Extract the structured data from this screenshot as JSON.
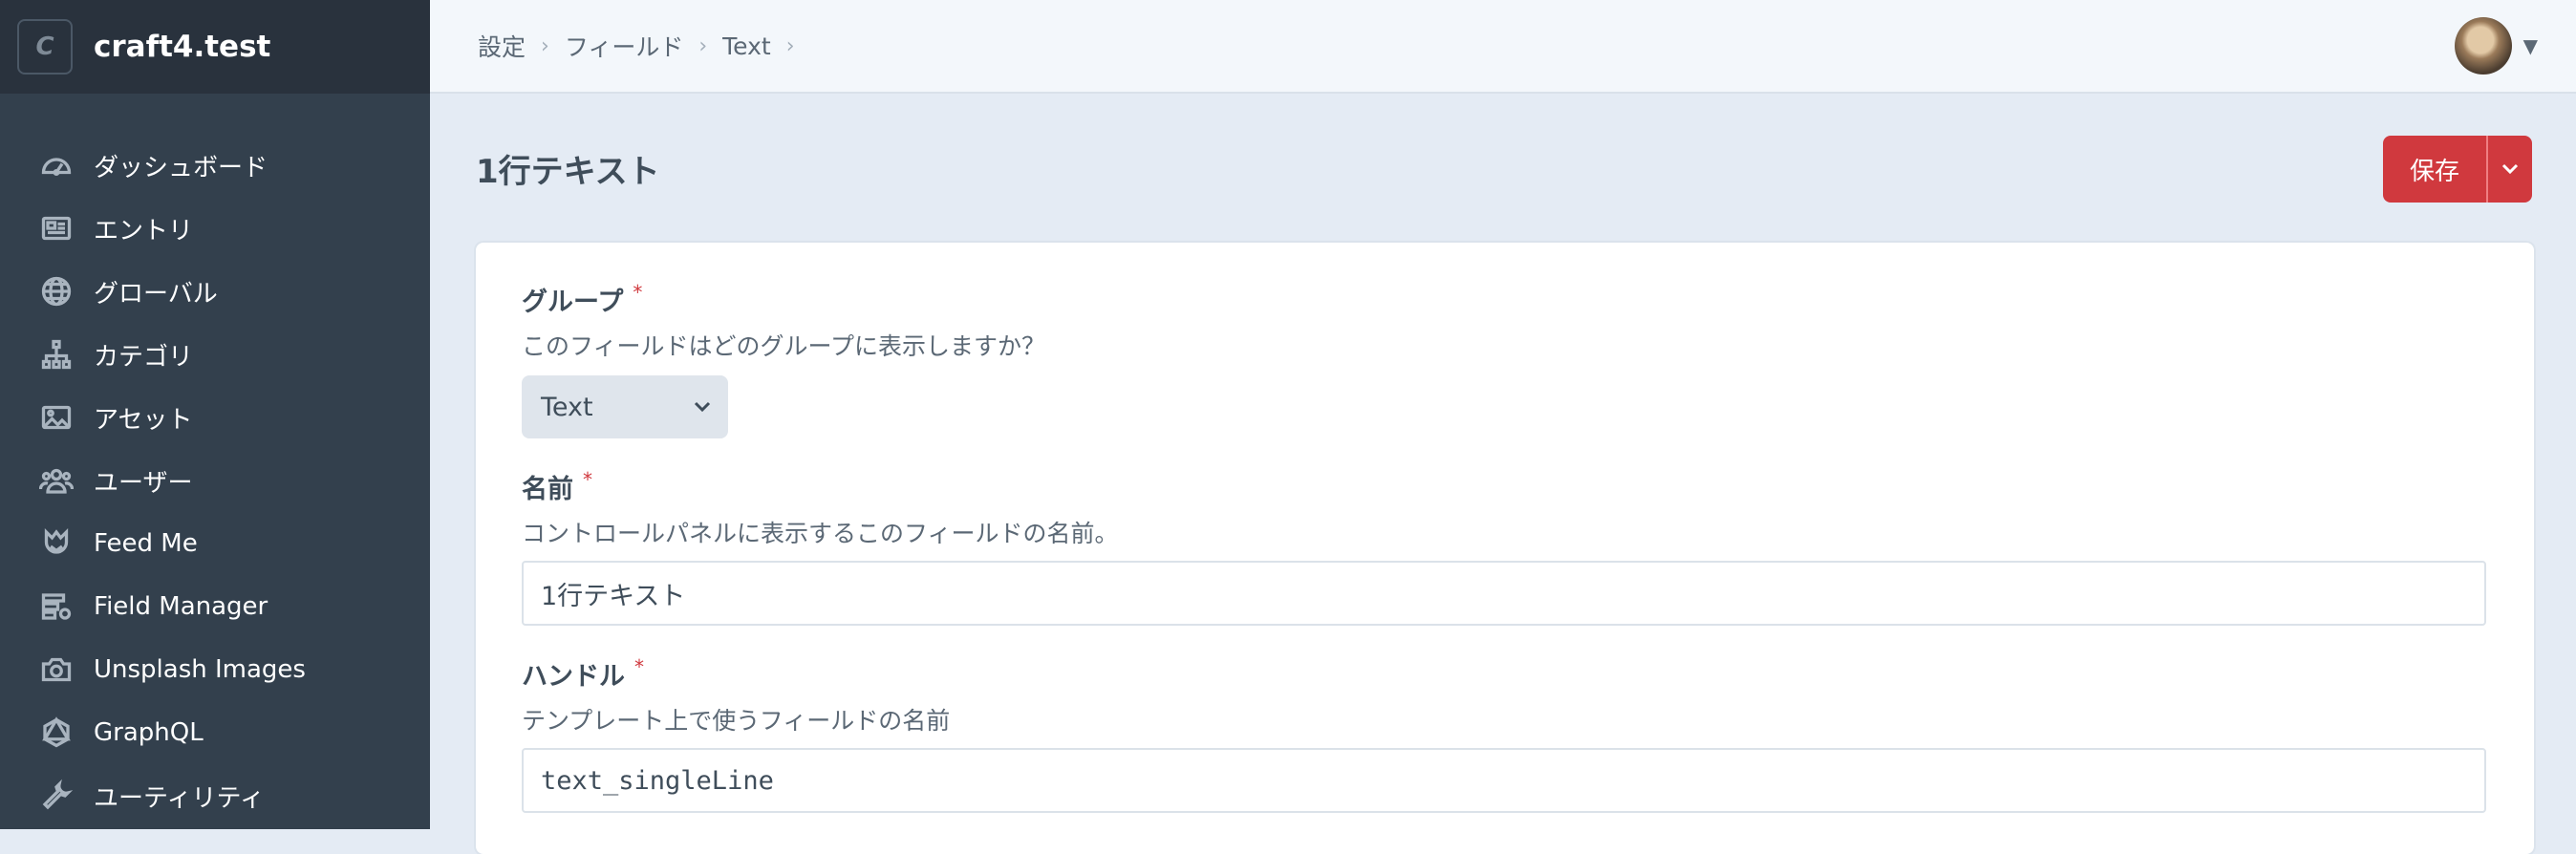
{
  "sidebar": {
    "site_icon": "C",
    "site_name": "craft4.test",
    "items": [
      {
        "label": "ダッシュボード",
        "icon": "gauge-icon"
      },
      {
        "label": "エントリ",
        "icon": "newspaper-icon"
      },
      {
        "label": "グローバル",
        "icon": "globe-icon"
      },
      {
        "label": "カテゴリ",
        "icon": "sitemap-icon"
      },
      {
        "label": "アセット",
        "icon": "image-icon"
      },
      {
        "label": "ユーザー",
        "icon": "users-icon"
      },
      {
        "label": "Feed Me",
        "icon": "feedme-icon"
      },
      {
        "label": "Field Manager",
        "icon": "field-manager-icon"
      },
      {
        "label": "Unsplash Images",
        "icon": "camera-icon"
      },
      {
        "label": "GraphQL",
        "icon": "graphql-icon"
      },
      {
        "label": "ユーティリティ",
        "icon": "wrench-icon"
      }
    ]
  },
  "breadcrumbs": [
    "設定",
    "フィールド",
    "Text"
  ],
  "page": {
    "title": "1行テキスト",
    "save_label": "保存"
  },
  "form": {
    "group": {
      "label": "グループ",
      "instructions": "このフィールドはどのグループに表示しますか？",
      "value": "Text"
    },
    "name": {
      "label": "名前",
      "instructions": "コントロールパネルに表示するこのフィールドの名前。",
      "value": "1行テキスト"
    },
    "handle": {
      "label": "ハンドル",
      "instructions": "テンプレート上で使うフィールドの名前",
      "value": "text_singleLine"
    },
    "required_marker": "*"
  },
  "colors": {
    "sidebar": "#33404d",
    "sidebar_header": "#29323d",
    "accent": "#d0393e",
    "page_bg": "#e4ebf4"
  }
}
